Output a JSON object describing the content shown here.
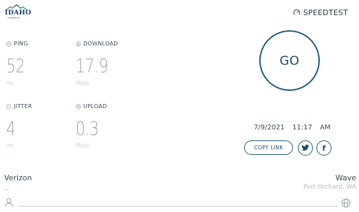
{
  "header": {
    "logo": {
      "name": "idaho-commerce-logo",
      "word": "IDAHO",
      "sub": "COMMERCE"
    },
    "brand": {
      "icon": "gauge-icon",
      "label": "SPEEDTEST"
    }
  },
  "metrics": {
    "ping": {
      "icon": "ping-icon",
      "label": "PING",
      "value": "52",
      "unit": "ms"
    },
    "download": {
      "icon": "download-icon",
      "label": "DOWNLOAD",
      "value": "17.9",
      "unit": "Mbps"
    },
    "jitter": {
      "icon": "jitter-icon",
      "label": "JITTER",
      "value": "4",
      "unit": "ms"
    },
    "upload": {
      "icon": "upload-icon",
      "label": "UPLOAD",
      "value": "0.3",
      "unit": "Mbps"
    }
  },
  "go_button": {
    "label": "GO"
  },
  "result": {
    "date": "7/9/2021",
    "time": "11:17 AM"
  },
  "share": {
    "copy_label": "COPY LINK",
    "twitter_icon": "twitter-icon",
    "facebook_icon": "facebook-icon",
    "facebook_glyph": "f"
  },
  "connection": {
    "isp": "Verizon",
    "server_name": "Wave",
    "server_location": "Port Orchard, WA",
    "user_icon": "user-icon",
    "globe_icon": "globe-icon"
  },
  "colors": {
    "accent": "#1d5a78",
    "value_gray": "#9aa5ab",
    "text": "#3a4a54"
  }
}
